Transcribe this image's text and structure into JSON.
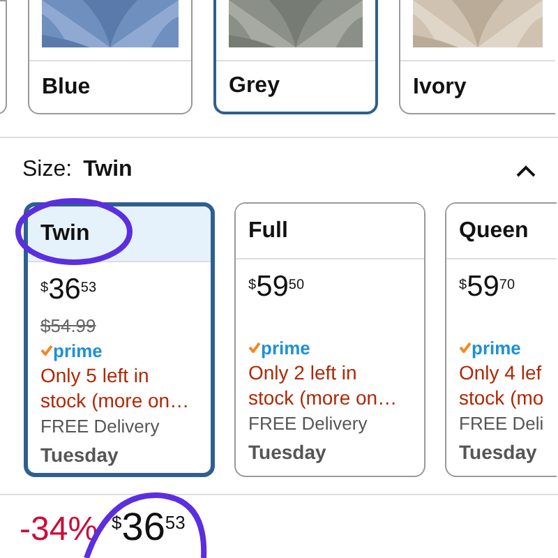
{
  "colors": [
    {
      "name": "Blue",
      "selected": false
    },
    {
      "name": "Grey",
      "selected": true
    },
    {
      "name": "Ivory",
      "selected": false
    }
  ],
  "size_label": {
    "label": "Size:",
    "value": "Twin",
    "expanded": true
  },
  "sizes": [
    {
      "name": "Twin",
      "selected": true,
      "currency": "$",
      "whole": "36",
      "fraction": "53",
      "list_price": "$54.99",
      "prime": "prime",
      "stock_lines": [
        "Only 5 left in",
        "stock (more on…"
      ],
      "delivery": "FREE Delivery",
      "day": "Tuesday"
    },
    {
      "name": "Full",
      "selected": false,
      "currency": "$",
      "whole": "59",
      "fraction": "50",
      "prime": "prime",
      "stock_lines": [
        "Only 2 left in",
        "stock (more on…"
      ],
      "delivery": "FREE Delivery",
      "day": "Tuesday"
    },
    {
      "name": "Queen",
      "selected": false,
      "currency": "$",
      "whole": "59",
      "fraction": "70",
      "prime": "prime",
      "stock_lines": [
        "Only 4 lef",
        "stock (mo"
      ],
      "delivery": "FREE Deli",
      "day": "Tuesday"
    }
  ],
  "price": {
    "discount": "-34%",
    "currency": "$",
    "whole": "36",
    "fraction": "53"
  }
}
